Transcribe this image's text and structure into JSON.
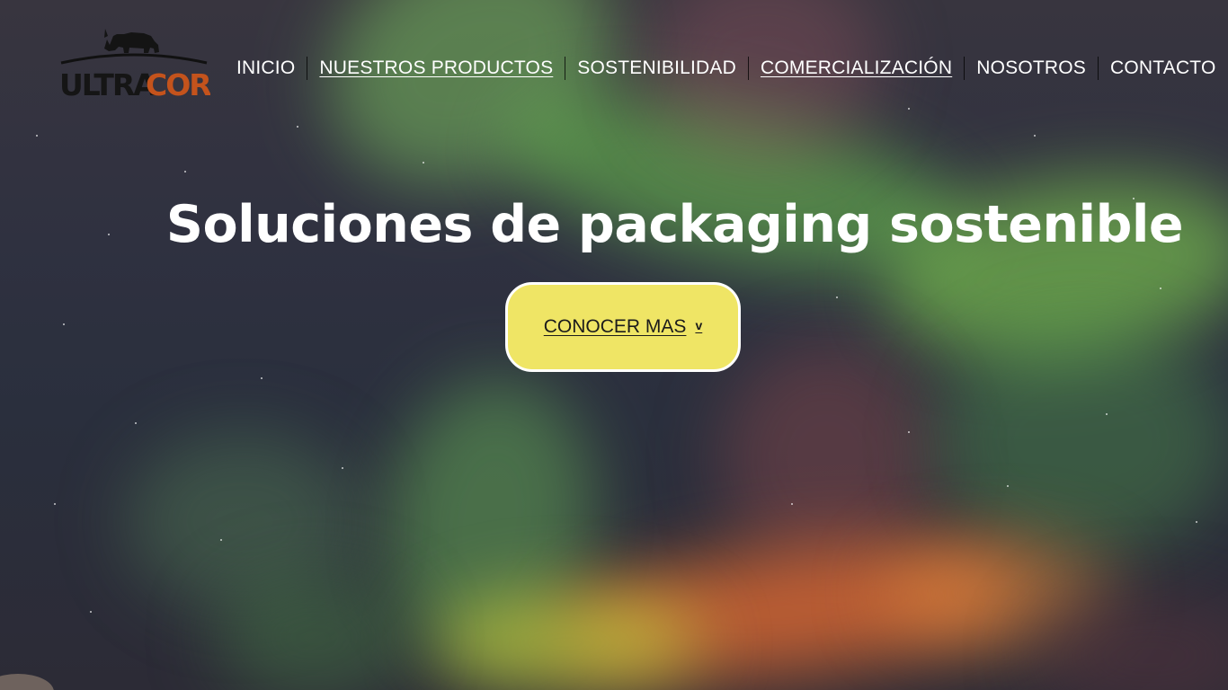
{
  "brand": {
    "name": "ULTRACOR",
    "name_part1": "ULTRA",
    "name_part2": "COR",
    "color_dark": "#1a1a1a",
    "color_accent": "#c4531c",
    "mascot_icon": "rhino-icon"
  },
  "nav": {
    "items": [
      {
        "label": "INICIO",
        "underlined": false
      },
      {
        "label": "NUESTROS PRODUCTOS",
        "underlined": true
      },
      {
        "label": "SOSTENIBILIDAD",
        "underlined": false
      },
      {
        "label": "COMERCIALIZACIÓN",
        "underlined": true
      },
      {
        "label": "NOSOTROS",
        "underlined": false
      },
      {
        "label": "CONTACTO",
        "underlined": false
      }
    ]
  },
  "hero": {
    "title": "Soluciones de packaging sostenible",
    "cta_label": "CONOCER MAS",
    "cta_icon": "chevron-down-icon",
    "cta_chevron_glyph": "v",
    "cta_color": "#efe565",
    "background": "aurora-night-sky"
  }
}
